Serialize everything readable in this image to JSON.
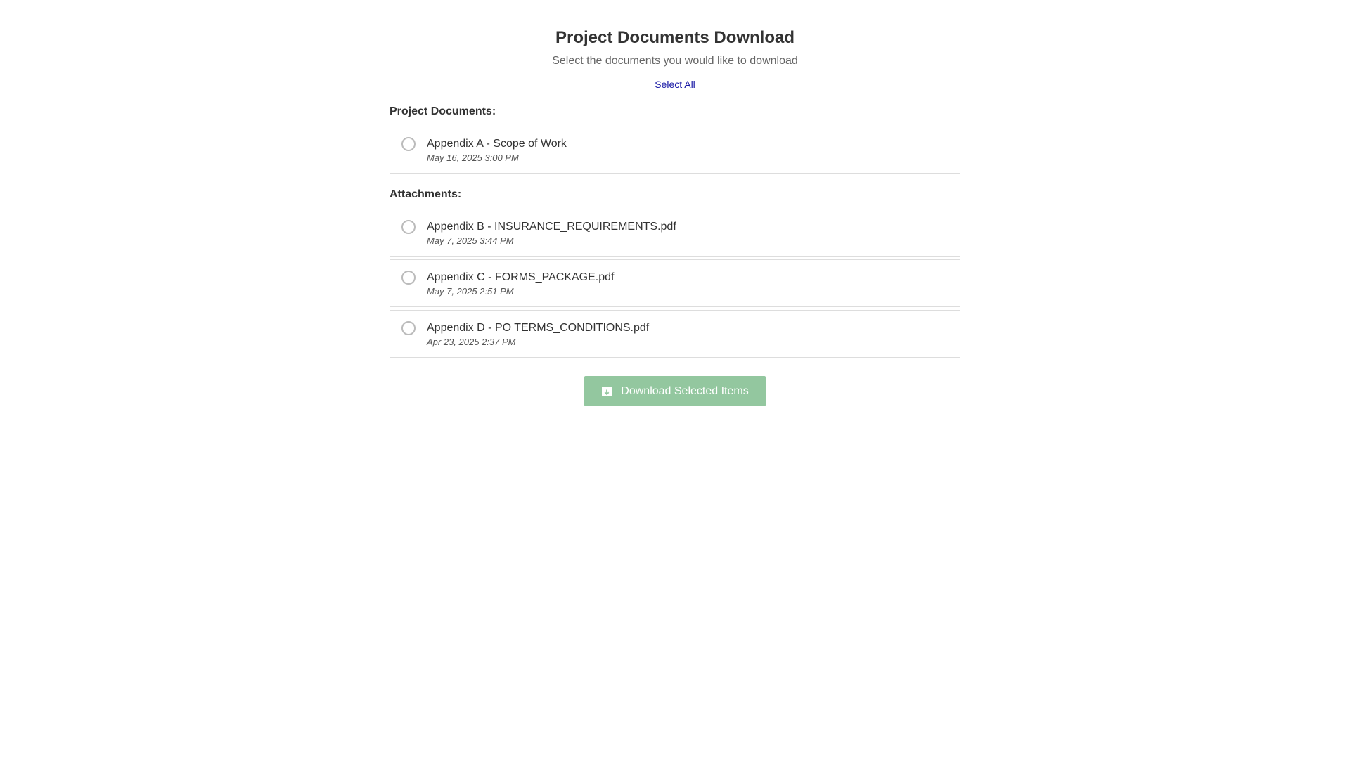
{
  "header": {
    "title": "Project Documents Download",
    "subtitle": "Select the documents you would like to download",
    "select_all_label": "Select All"
  },
  "project_documents": {
    "label": "Project Documents:",
    "items": [
      {
        "name": "Appendix A - Scope of Work",
        "date": "May 16, 2025 3:00 PM"
      }
    ]
  },
  "attachments": {
    "label": "Attachments:",
    "items": [
      {
        "name": "Appendix B - INSURANCE_REQUIREMENTS.pdf",
        "date": "May 7, 2025 3:44 PM"
      },
      {
        "name": "Appendix C - FORMS_PACKAGE.pdf",
        "date": "May 7, 2025 2:51 PM"
      },
      {
        "name": "Appendix D - PO TERMS_CONDITIONS.pdf",
        "date": "Apr 23, 2025 2:37 PM"
      }
    ]
  },
  "actions": {
    "download_label": "Download Selected Items",
    "download_icon": "download-box-icon"
  },
  "colors": {
    "button_bg": "#93c79f",
    "link": "#1a1aa6"
  }
}
